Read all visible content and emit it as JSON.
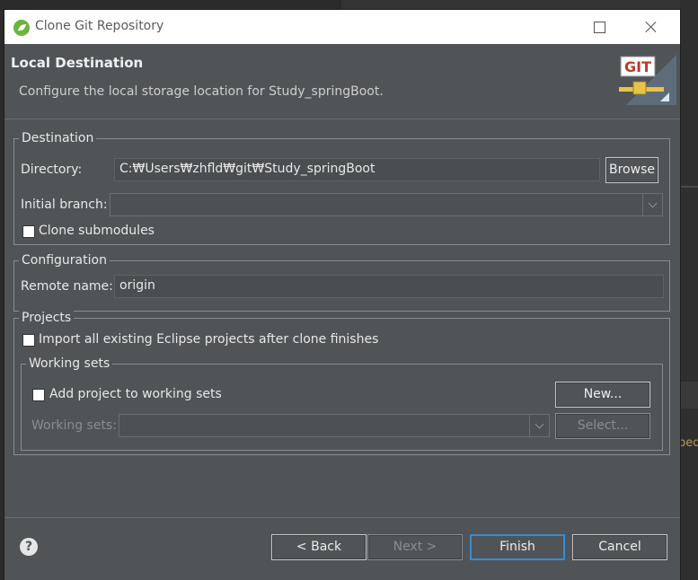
{
  "window": {
    "title": "Clone Git Repository"
  },
  "header": {
    "title": "Local Destination",
    "description": "Configure the local storage location for Study_springBoot.",
    "image_label": "GIT"
  },
  "destination": {
    "group_label": "Destination",
    "directory_label": "Directory:",
    "directory_value": "C:₩Users₩zhfld₩git₩Study_springBoot",
    "browse_label": "Browse",
    "initial_branch_label": "Initial branch:",
    "initial_branch_value": "",
    "clone_submodules_label": "Clone submodules",
    "clone_submodules_checked": false
  },
  "configuration": {
    "group_label": "Configuration",
    "remote_name_label": "Remote name:",
    "remote_name_value": "origin"
  },
  "projects": {
    "group_label": "Projects",
    "import_label": "Import all existing Eclipse projects after clone finishes",
    "import_checked": false,
    "working_sets": {
      "group_label": "Working sets",
      "add_label": "Add project to working sets",
      "add_checked": false,
      "new_label": "New...",
      "working_sets_label": "Working sets:",
      "working_sets_value": "",
      "select_label": "Select..."
    }
  },
  "footer": {
    "help_icon": "?",
    "back_label": "< Back",
    "next_label": "Next >",
    "finish_label": "Finish",
    "cancel_label": "Cancel"
  },
  "background": {
    "fragment_text": "ped"
  },
  "colors": {
    "dialog_bg": "#505456",
    "titlebar_bg": "#ffffff",
    "accent": "#2e8fd8"
  }
}
